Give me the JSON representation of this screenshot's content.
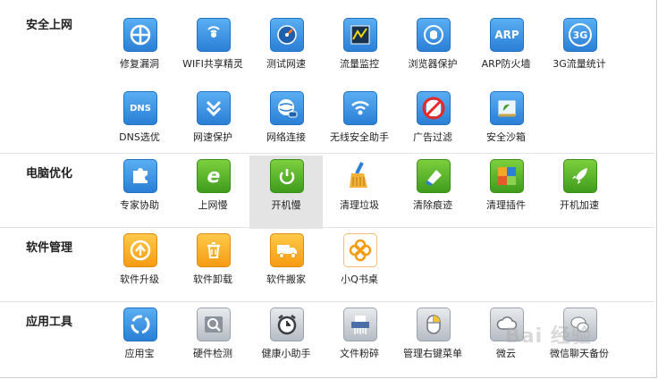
{
  "sections": [
    {
      "title": "安全上网",
      "tools": [
        "修复漏洞",
        "WIFI共享精灵",
        "测试网速",
        "流量监控",
        "浏览器保护",
        "ARP防火墙",
        "3G流量统计",
        "DNS选优",
        "网速保护",
        "网络连接",
        "无线安全助手",
        "广告过滤",
        "安全沙箱"
      ]
    },
    {
      "title": "电脑优化",
      "tools": [
        "专家协助",
        "上网慢",
        "开机慢",
        "清理垃圾",
        "清除痕迹",
        "清理插件",
        "开机加速"
      ]
    },
    {
      "title": "软件管理",
      "tools": [
        "软件升级",
        "软件卸载",
        "软件搬家",
        "小Q书桌"
      ]
    },
    {
      "title": "应用工具",
      "tools": [
        "应用宝",
        "硬件检测",
        "健康小助手",
        "文件粉碎",
        "管理右键菜单",
        "微云",
        "微信聊天备份"
      ]
    }
  ],
  "icon_text": {
    "arp": "ARP",
    "3g": "3G",
    "dns": "DNS",
    "ad": "广告"
  },
  "watermark": "Bai 经验",
  "icons": {
    "s0": [
      "repair-vulnerability-icon",
      "wifi-share-icon",
      "speed-test-icon",
      "traffic-monitor-icon",
      "browser-protect-icon",
      "arp-firewall-icon",
      "3g-traffic-icon",
      "dns-icon",
      "net-speed-protect-icon",
      "network-connection-icon",
      "wireless-security-icon",
      "ad-block-icon",
      "sandbox-icon"
    ],
    "s1": [
      "puzzle-icon",
      "ie-browser-icon",
      "power-icon",
      "broom-icon",
      "eraser-icon",
      "plugin-puzzle-icon",
      "rocket-icon"
    ],
    "s2": [
      "upgrade-arrow-icon",
      "trash-icon",
      "truck-icon",
      "clover-icon"
    ],
    "s3": [
      "app-store-icon",
      "hardware-check-icon",
      "alarm-clock-icon",
      "shredder-icon",
      "mouse-icon",
      "cloud-icon",
      "wechat-backup-icon"
    ]
  },
  "colors": {
    "blue": "#2b7fd6",
    "green": "#3f9c1c",
    "orange": "#f59b12",
    "selected_bg": "#e4e4e4"
  },
  "selected_tool": "开机慢"
}
